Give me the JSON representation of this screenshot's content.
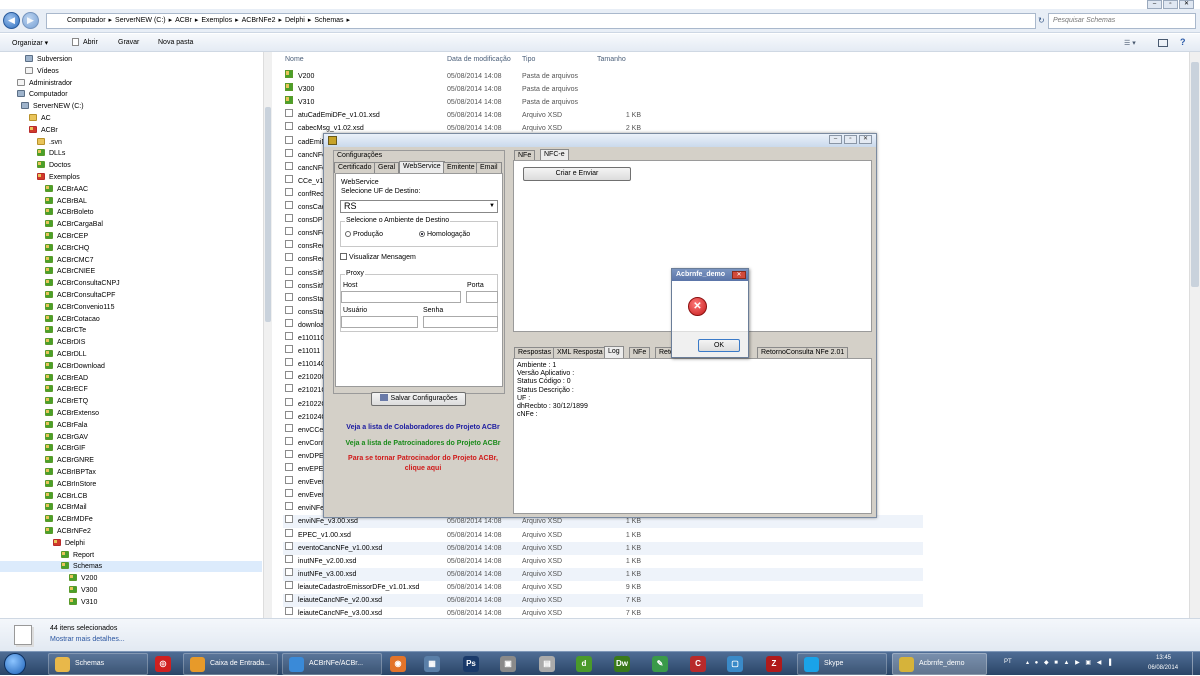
{
  "explorer": {
    "breadcrumb": [
      "Computador",
      "ServerNEW (C:)",
      "ACBr",
      "Exemplos",
      "ACBrNFe2",
      "Delphi",
      "Schemas"
    ],
    "search_placeholder": "Pesquisar Schemas",
    "toolbar": {
      "organize": "Organizar ▾",
      "open": "Abrir",
      "save": "Gravar",
      "new_folder": "Nova pasta"
    },
    "columns": {
      "name": "Nome",
      "date": "Data de modificação",
      "type": "Tipo",
      "size": "Tamanho"
    },
    "tree": [
      {
        "label": "Subversion",
        "icon": "drive"
      },
      {
        "label": "Vídeos",
        "icon": "doc"
      },
      {
        "label": "Administrador",
        "icon": "doc"
      },
      {
        "label": "Computador",
        "icon": "drive"
      },
      {
        "label": "ServerNEW (C:)",
        "icon": "drive"
      },
      {
        "label": "AC",
        "icon": "folder"
      },
      {
        "label": "ACBr",
        "icon": "red"
      },
      {
        "label": ".svn",
        "icon": "folder"
      },
      {
        "label": "DLLs",
        "icon": "green"
      },
      {
        "label": "Doctos",
        "icon": "green"
      },
      {
        "label": "Exemplos",
        "icon": "red"
      },
      {
        "label": "ACBrAAC",
        "icon": "green"
      },
      {
        "label": "ACBrBAL",
        "icon": "green"
      },
      {
        "label": "ACBrBoleto",
        "icon": "green"
      },
      {
        "label": "ACBrCargaBal",
        "icon": "green"
      },
      {
        "label": "ACBrCEP",
        "icon": "green"
      },
      {
        "label": "ACBrCHQ",
        "icon": "green"
      },
      {
        "label": "ACBrCMC7",
        "icon": "green"
      },
      {
        "label": "ACBrCNIEE",
        "icon": "green"
      },
      {
        "label": "ACBrConsultaCNPJ",
        "icon": "green"
      },
      {
        "label": "ACBrConsultaCPF",
        "icon": "green"
      },
      {
        "label": "ACBrConvenio115",
        "icon": "green"
      },
      {
        "label": "ACBrCotacao",
        "icon": "green"
      },
      {
        "label": "ACBrCTe",
        "icon": "green"
      },
      {
        "label": "ACBrDIS",
        "icon": "green"
      },
      {
        "label": "ACBrDLL",
        "icon": "green"
      },
      {
        "label": "ACBrDownload",
        "icon": "green"
      },
      {
        "label": "ACBrEAD",
        "icon": "green"
      },
      {
        "label": "ACBrECF",
        "icon": "green"
      },
      {
        "label": "ACBrETQ",
        "icon": "green"
      },
      {
        "label": "ACBrExtenso",
        "icon": "green"
      },
      {
        "label": "ACBrFala",
        "icon": "green"
      },
      {
        "label": "ACBrGAV",
        "icon": "green"
      },
      {
        "label": "ACBrGIF",
        "icon": "green"
      },
      {
        "label": "ACBrGNRE",
        "icon": "green"
      },
      {
        "label": "ACBrIBPTax",
        "icon": "green"
      },
      {
        "label": "ACBrInStore",
        "icon": "green"
      },
      {
        "label": "ACBrLCB",
        "icon": "green"
      },
      {
        "label": "ACBrMail",
        "icon": "green"
      },
      {
        "label": "ACBrMDFe",
        "icon": "green"
      },
      {
        "label": "ACBrNFe2",
        "icon": "green"
      },
      {
        "label": "Delphi",
        "icon": "red"
      },
      {
        "label": "Report",
        "icon": "green"
      },
      {
        "label": "Schemas",
        "icon": "green"
      },
      {
        "label": "V200",
        "icon": "green"
      },
      {
        "label": "V300",
        "icon": "green"
      },
      {
        "label": "V310",
        "icon": "green"
      }
    ],
    "files": [
      {
        "name": "V200",
        "date": "05/08/2014 14:08",
        "type": "Pasta de arquivos",
        "size": "",
        "icon": "folder"
      },
      {
        "name": "V300",
        "date": "05/08/2014 14:08",
        "type": "Pasta de arquivos",
        "size": "",
        "icon": "folder"
      },
      {
        "name": "V310",
        "date": "05/08/2014 14:08",
        "type": "Pasta de arquivos",
        "size": "",
        "icon": "folder"
      },
      {
        "name": "atuCadEmiDFe_v1.01.xsd",
        "date": "05/08/2014 14:08",
        "type": "Arquivo XSD",
        "size": "1 KB",
        "icon": "doc"
      },
      {
        "name": "cabecMsg_v1.02.xsd",
        "date": "05/08/2014 14:08",
        "type": "Arquivo XSD",
        "size": "2 KB",
        "icon": "doc"
      },
      {
        "name": "cadEmiD",
        "date": "",
        "type": "",
        "size": "",
        "icon": "doc"
      },
      {
        "name": "cancNFe",
        "date": "",
        "type": "",
        "size": "",
        "icon": "doc"
      },
      {
        "name": "cancNFe",
        "date": "",
        "type": "",
        "size": "",
        "icon": "doc"
      },
      {
        "name": "CCe_v1.",
        "date": "",
        "type": "",
        "size": "",
        "icon": "doc"
      },
      {
        "name": "confRec",
        "date": "",
        "type": "",
        "size": "",
        "icon": "doc"
      },
      {
        "name": "consCad",
        "date": "",
        "type": "",
        "size": "",
        "icon": "doc"
      },
      {
        "name": "consDPE",
        "date": "",
        "type": "",
        "size": "",
        "icon": "doc"
      },
      {
        "name": "consNFe",
        "date": "",
        "type": "",
        "size": "",
        "icon": "doc"
      },
      {
        "name": "consRec",
        "date": "",
        "type": "",
        "size": "",
        "icon": "doc"
      },
      {
        "name": "consRec",
        "date": "",
        "type": "",
        "size": "",
        "icon": "doc"
      },
      {
        "name": "consSitN",
        "date": "",
        "type": "",
        "size": "",
        "icon": "doc"
      },
      {
        "name": "consSitN",
        "date": "",
        "type": "",
        "size": "",
        "icon": "doc"
      },
      {
        "name": "consStat",
        "date": "",
        "type": "",
        "size": "",
        "icon": "doc"
      },
      {
        "name": "consStat",
        "date": "",
        "type": "",
        "size": "",
        "icon": "doc"
      },
      {
        "name": "downloa",
        "date": "",
        "type": "",
        "size": "",
        "icon": "doc"
      },
      {
        "name": "e11011C",
        "date": "",
        "type": "",
        "size": "",
        "icon": "doc"
      },
      {
        "name": "e11011",
        "date": "",
        "type": "",
        "size": "",
        "icon": "doc"
      },
      {
        "name": "e11014C",
        "date": "",
        "type": "",
        "size": "",
        "icon": "doc"
      },
      {
        "name": "e21020C",
        "date": "",
        "type": "",
        "size": "",
        "icon": "doc"
      },
      {
        "name": "e21021C",
        "date": "",
        "type": "",
        "size": "",
        "icon": "doc"
      },
      {
        "name": "e21022C",
        "date": "",
        "type": "",
        "size": "",
        "icon": "doc"
      },
      {
        "name": "e21024C",
        "date": "",
        "type": "",
        "size": "",
        "icon": "doc"
      },
      {
        "name": "envCCe",
        "date": "",
        "type": "",
        "size": "",
        "icon": "doc"
      },
      {
        "name": "envConf",
        "date": "",
        "type": "",
        "size": "",
        "icon": "doc"
      },
      {
        "name": "envDPEC",
        "date": "",
        "type": "",
        "size": "",
        "icon": "doc"
      },
      {
        "name": "envEPEC",
        "date": "",
        "type": "",
        "size": "",
        "icon": "doc"
      },
      {
        "name": "envEven",
        "date": "",
        "type": "",
        "size": "",
        "icon": "doc"
      },
      {
        "name": "envEven",
        "date": "",
        "type": "",
        "size": "",
        "icon": "doc"
      },
      {
        "name": "enviNFe",
        "date": "",
        "type": "",
        "size": "",
        "icon": "doc"
      },
      {
        "name": "enviNFe_v3.00.xsd",
        "date": "05/08/2014 14:08",
        "type": "Arquivo XSD",
        "size": "1 KB",
        "icon": "doc"
      },
      {
        "name": "EPEC_v1.00.xsd",
        "date": "05/08/2014 14:08",
        "type": "Arquivo XSD",
        "size": "1 KB",
        "icon": "doc"
      },
      {
        "name": "eventoCancNFe_v1.00.xsd",
        "date": "05/08/2014 14:08",
        "type": "Arquivo XSD",
        "size": "1 KB",
        "icon": "doc"
      },
      {
        "name": "inutNFe_v2.00.xsd",
        "date": "05/08/2014 14:08",
        "type": "Arquivo XSD",
        "size": "1 KB",
        "icon": "doc"
      },
      {
        "name": "inutNFe_v3.00.xsd",
        "date": "05/08/2014 14:08",
        "type": "Arquivo XSD",
        "size": "1 KB",
        "icon": "doc"
      },
      {
        "name": "leiauteCadastroEmissorDFe_v1.01.xsd",
        "date": "05/08/2014 14:08",
        "type": "Arquivo XSD",
        "size": "9 KB",
        "icon": "doc"
      },
      {
        "name": "leiauteCancNFe_v2.00.xsd",
        "date": "05/08/2014 14:08",
        "type": "Arquivo XSD",
        "size": "7 KB",
        "icon": "doc"
      },
      {
        "name": "leiauteCancNFe_v3.00.xsd",
        "date": "05/08/2014 14:08",
        "type": "Arquivo XSD",
        "size": "7 KB",
        "icon": "doc"
      }
    ],
    "status": {
      "count": "44 itens selecionados",
      "more": "Mostrar mais detalhes..."
    }
  },
  "app": {
    "config_group": "Configurações",
    "tabs": [
      "Certificado",
      "Geral",
      "WebService",
      "Emitente",
      "Email"
    ],
    "ws_group": "WebService",
    "uf_label": "Selecione UF de Destino:",
    "uf_value": "RS",
    "amb_group": "Selecione o Ambiente de Destino",
    "amb_prod": "Produção",
    "amb_homol": "Homologação",
    "view_msg": "Visualizar Mensagem",
    "proxy_group": "Proxy",
    "host": "Host",
    "port": "Porta",
    "user": "Usuário",
    "pass": "Senha",
    "save_btn": "Salvar Configurações",
    "link1": "Veja a lista de Colaboradores do Projeto ACBr",
    "link2": "Veja a lista de Patrocinadores do Projeto ACBr",
    "link3a": "Para se tornar Patrocinador do Projeto ACBr,",
    "link3b": "clique aqui",
    "top_tabs": [
      "NFe",
      "NFC-e"
    ],
    "create_btn": "Criar e Enviar",
    "bottom_tabs": [
      "Respostas",
      "XML Resposta",
      "Log",
      "NFe",
      "Reto",
      "RetornoConsulta NFe 2.01"
    ],
    "log_lines": [
      "Ambiente : 1",
      "Versão Aplicativo :",
      "Status Código : 0",
      "Status Descrição :",
      "UF :",
      "dhRecbto : 30/12/1899",
      "cNFe :"
    ]
  },
  "dialog": {
    "title": "Acbrnfe_demo",
    "ok": "OK"
  },
  "taskbar": {
    "tasks": [
      {
        "label": "Schemas",
        "color": "#e8b84a"
      },
      {
        "label": "Caixa de Entrada...",
        "color": "#e79a2a"
      },
      {
        "label": "ACBrNFe/ACBr...",
        "color": "#3a8ad8"
      },
      {
        "label": "Skype",
        "color": "#1aa3e8"
      },
      {
        "label": "Acbrnfe_demo",
        "color": "#d6b33a"
      }
    ],
    "pins": [
      {
        "icon": "security-icon",
        "glyph": "◎",
        "color": "#d02020"
      },
      {
        "icon": "firefox-icon",
        "glyph": "◉",
        "color": "#e3742a"
      },
      {
        "icon": "tool-icon",
        "glyph": "▦",
        "color": "#5a7fa8"
      },
      {
        "icon": "photoshop-icon",
        "glyph": "Ps",
        "color": "#1a3a6a"
      },
      {
        "icon": "archive-icon",
        "glyph": "▣",
        "color": "#8a8a8a"
      },
      {
        "icon": "printer-icon",
        "glyph": "▤",
        "color": "#aaaaaa"
      },
      {
        "icon": "dreamweaver-green-icon",
        "glyph": "d",
        "color": "#4a9a2a"
      },
      {
        "icon": "dreamweaver-icon",
        "glyph": "Dw",
        "color": "#3a7a1a"
      },
      {
        "icon": "pen-icon",
        "glyph": "✎",
        "color": "#3a9a4a"
      },
      {
        "icon": "ccleaner-icon",
        "glyph": "C",
        "color": "#b82a2a"
      },
      {
        "icon": "remote-icon",
        "glyph": "▢",
        "color": "#3a8ac8"
      },
      {
        "icon": "filezilla-icon",
        "glyph": "Z",
        "color": "#b01a1a"
      }
    ],
    "lang": "PT",
    "time": "13:45",
    "date": "06/08/2014"
  }
}
